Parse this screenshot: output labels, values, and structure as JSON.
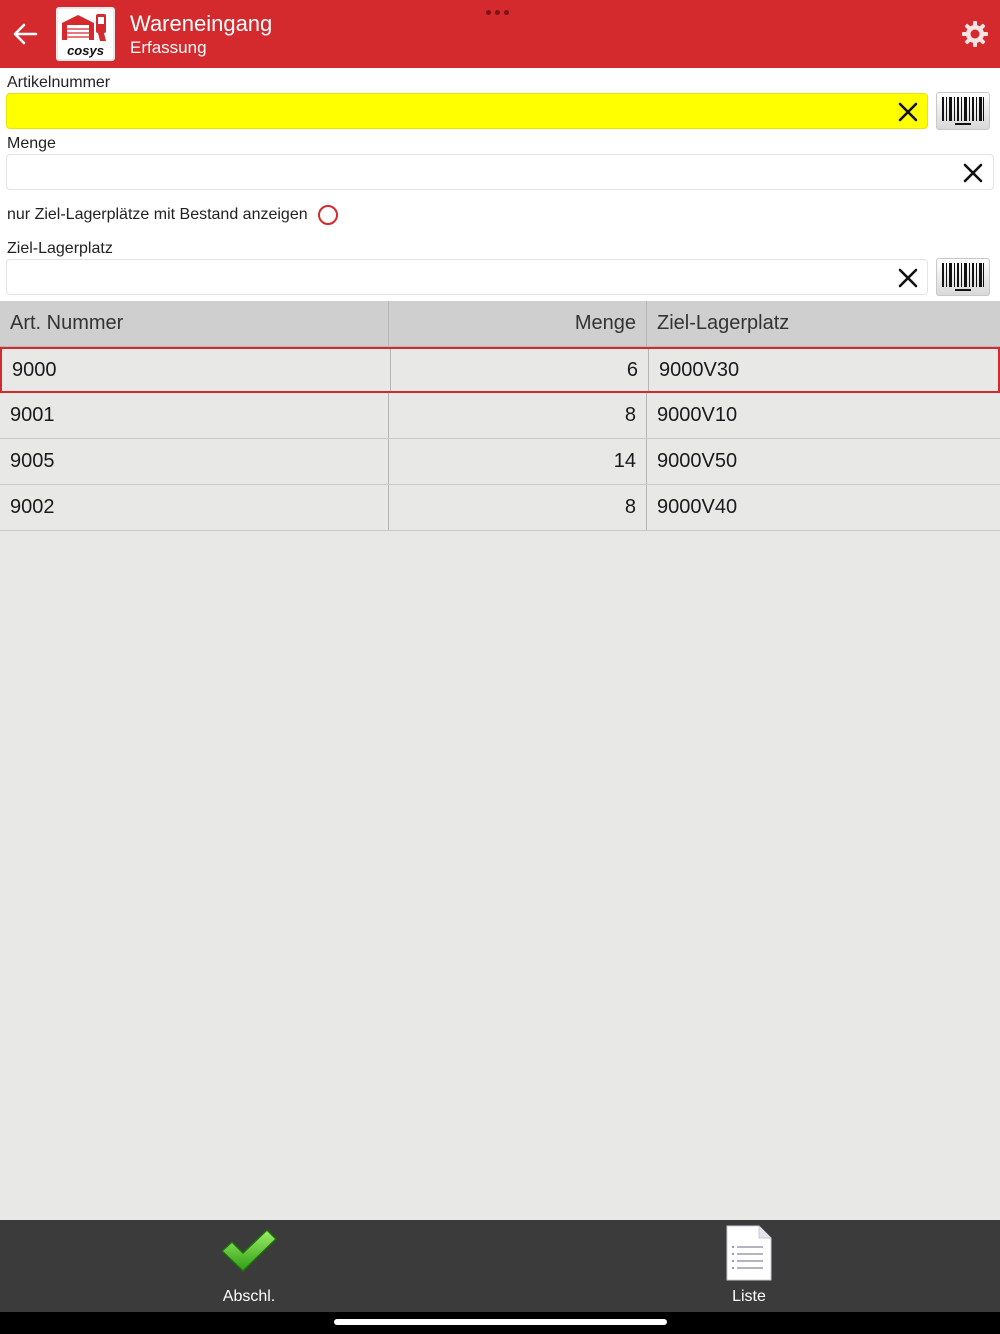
{
  "header": {
    "title": "Wareneingang",
    "subtitle": "Erfassung",
    "logo_text": "cosys",
    "accent_color": "#d42a2e",
    "back_icon": "arrow-left-icon",
    "settings_icon": "gear-icon"
  },
  "form": {
    "article_number": {
      "label": "Artikelnummer",
      "value": "",
      "placeholder": ""
    },
    "quantity": {
      "label": "Menge",
      "value": "",
      "placeholder": ""
    },
    "stock_only_toggle": {
      "label": "nur Ziel-Lagerplätze mit Bestand anzeigen",
      "checked": false
    },
    "target_location": {
      "label": "Ziel-Lagerplatz",
      "value": "",
      "placeholder": ""
    }
  },
  "table": {
    "columns": [
      "Art. Nummer",
      "Menge",
      "Ziel-Lagerplatz"
    ],
    "rows": [
      {
        "article": "9000",
        "quantity": "6",
        "location": "9000V30",
        "selected": true
      },
      {
        "article": "9001",
        "quantity": "8",
        "location": "9000V10",
        "selected": false
      },
      {
        "article": "9005",
        "quantity": "14",
        "location": "9000V50",
        "selected": false
      },
      {
        "article": "9002",
        "quantity": "8",
        "location": "9000V40",
        "selected": false
      }
    ]
  },
  "bottom_bar": {
    "finish_label": "Abschl.",
    "finish_icon": "checkmark-icon",
    "list_label": "Liste",
    "list_icon": "document-list-icon"
  }
}
